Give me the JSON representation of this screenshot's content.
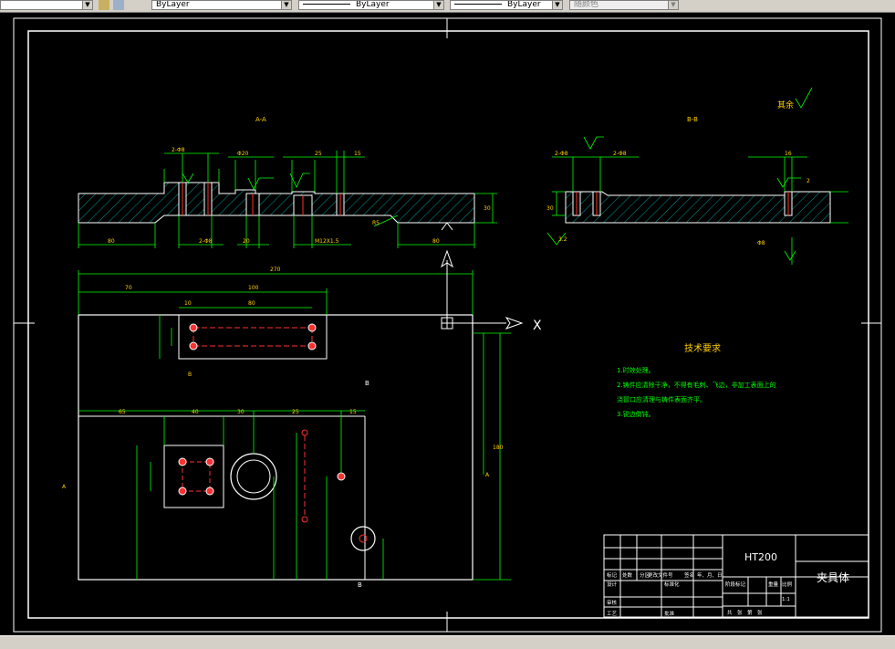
{
  "toolbar": {
    "layer_combo": "ByLayer",
    "linetype_combo": "ByLayer",
    "lineweight_combo": "ByLayer",
    "color_combo": "随颜色"
  },
  "drawing": {
    "section_aa": "A-A",
    "section_bb": "B-B",
    "roughness_rest": "其余",
    "tech_title": "技术要求",
    "tech_lines": [
      "1.时效处理。",
      "2.铸件应清除干净，不得有毛刺、飞边，非加工表面上的",
      "浇冒口应清理与铸件表面齐平。",
      "3.锐边倒钝。"
    ],
    "dims": {
      "d80_left": "80",
      "d80_right": "80",
      "d270": "270",
      "d70": "70",
      "d100": "100",
      "d10": "10",
      "d80_inner": "80",
      "d180": "180",
      "d65": "65",
      "d40": "40",
      "d25": "25",
      "d15": "15",
      "d20": "20",
      "d30": "30",
      "d16": "16",
      "m": "M12X1.5",
      "rough_32": "3.2",
      "label_b": "B",
      "label_a": "A"
    },
    "title_block": {
      "material": "HT200",
      "name": "夹具体",
      "scale": "1:1",
      "row_labels": [
        "标记",
        "处数",
        "分区",
        "更改文件号",
        "签名",
        "年、月、日"
      ],
      "design": "设计",
      "standard": "标准化",
      "review": "审核",
      "process": "工艺",
      "approve": "批准",
      "stage": "阶段标记",
      "weight": "重量",
      "ratio": "比例",
      "sheets": "共　张　第　张"
    }
  },
  "ucs": {
    "x": "X",
    "y": "Y"
  }
}
